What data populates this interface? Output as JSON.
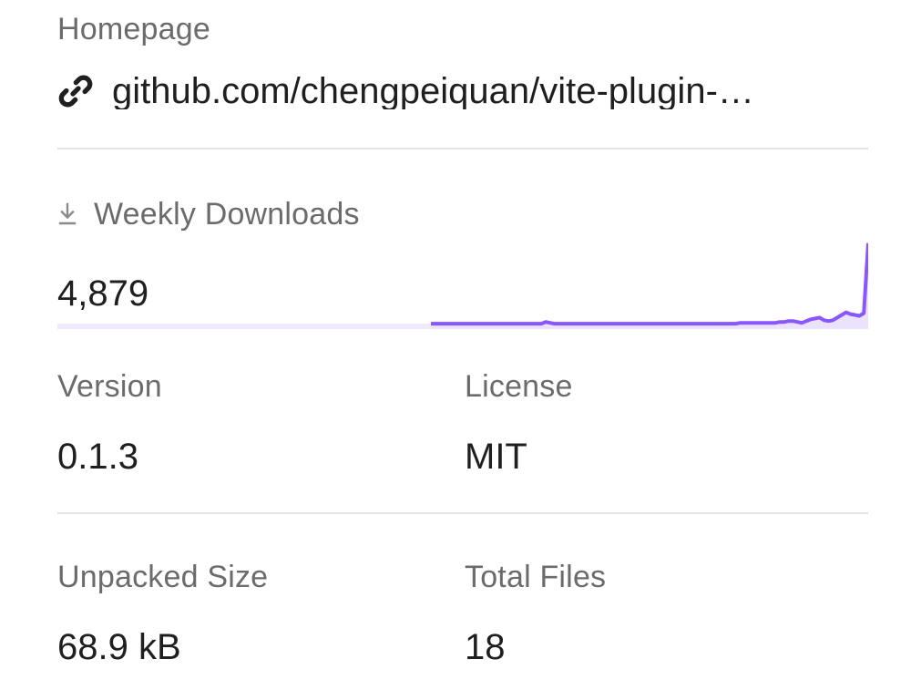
{
  "homepage": {
    "label": "Homepage",
    "url_text": "github.com/chengpeiquan/vite-plugin-…",
    "icon": "link-icon"
  },
  "weekly_downloads": {
    "label": "Weekly Downloads",
    "icon": "download-icon",
    "count": "4,879",
    "trend": [
      1,
      1,
      1,
      1,
      1,
      1,
      1,
      1,
      1,
      1,
      1,
      1,
      1,
      1,
      1,
      1,
      1,
      1,
      1,
      1,
      1,
      1,
      1,
      1,
      1,
      1,
      1,
      1,
      1,
      1,
      1,
      1,
      1,
      1,
      1,
      1,
      1,
      1,
      1,
      1,
      1,
      1,
      1,
      1,
      1,
      1,
      1,
      1,
      1,
      1,
      1,
      1,
      1,
      1,
      1,
      1,
      1,
      1,
      1,
      1,
      1,
      1,
      1,
      1,
      1,
      1,
      1,
      1,
      1,
      1,
      1,
      1,
      1,
      1,
      1,
      1,
      1,
      1,
      1,
      1,
      1,
      1,
      1,
      1,
      1,
      1,
      1,
      1,
      1,
      1,
      1,
      1,
      1,
      1,
      1,
      1,
      1,
      1,
      1,
      1
    ],
    "trend_scaled": [
      0,
      0,
      0,
      0,
      0,
      0,
      0,
      0,
      0,
      0,
      0,
      0,
      0,
      0,
      0,
      0,
      0,
      0,
      0,
      0,
      0,
      0,
      0,
      0,
      0,
      0,
      0,
      0,
      0,
      0,
      0,
      0,
      0,
      0,
      0,
      0,
      0,
      0,
      0,
      0,
      0,
      0,
      0,
      0,
      0,
      0,
      0,
      0,
      0,
      0,
      0,
      0,
      0,
      0,
      0,
      0,
      0,
      0,
      0,
      0,
      0,
      0,
      0,
      0,
      0,
      0,
      0,
      0,
      0,
      0,
      0,
      0,
      0,
      0,
      0,
      0,
      0,
      0,
      0,
      0,
      0,
      0,
      0,
      0,
      0,
      0,
      0,
      0,
      0,
      0,
      0,
      0,
      0,
      0,
      0,
      0,
      0,
      0,
      0,
      0
    ],
    "trend_points": [
      0.03,
      0.03,
      0.03,
      0.03,
      0.03,
      0.03,
      0.03,
      0.03,
      0.03,
      0.03,
      0.03,
      0.03,
      0.03,
      0.03,
      0.03,
      0.03,
      0.03,
      0.03,
      0.03,
      0.03,
      0.03,
      0.03,
      0.03,
      0.03,
      0.03,
      0.03,
      0.05,
      0.04,
      0.03,
      0.03,
      0.03,
      0.03,
      0.03,
      0.03,
      0.03,
      0.03,
      0.03,
      0.03,
      0.03,
      0.03,
      0.03,
      0.03,
      0.03,
      0.03,
      0.03,
      0.03,
      0.03,
      0.03,
      0.03,
      0.03,
      0.03,
      0.03,
      0.03,
      0.03,
      0.03,
      0.03,
      0.03,
      0.03,
      0.03,
      0.03,
      0.03,
      0.03,
      0.03,
      0.03,
      0.03,
      0.03,
      0.03,
      0.03,
      0.03,
      0.03,
      0.04,
      0.04,
      0.04,
      0.04,
      0.04,
      0.04,
      0.04,
      0.04,
      0.04,
      0.05,
      0.05,
      0.06,
      0.06,
      0.05,
      0.04,
      0.06,
      0.08,
      0.09,
      0.1,
      0.07,
      0.06,
      0.07,
      0.1,
      0.13,
      0.16,
      0.14,
      0.13,
      0.12,
      0.15,
      0.95
    ],
    "line_color": "#8956ff",
    "fill_color": "#ebe3fd"
  },
  "version": {
    "label": "Version",
    "value": "0.1.3"
  },
  "license": {
    "label": "License",
    "value": "MIT"
  },
  "unpacked_size": {
    "label": "Unpacked Size",
    "value": "68.9 kB"
  },
  "total_files": {
    "label": "Total Files",
    "value": "18"
  }
}
